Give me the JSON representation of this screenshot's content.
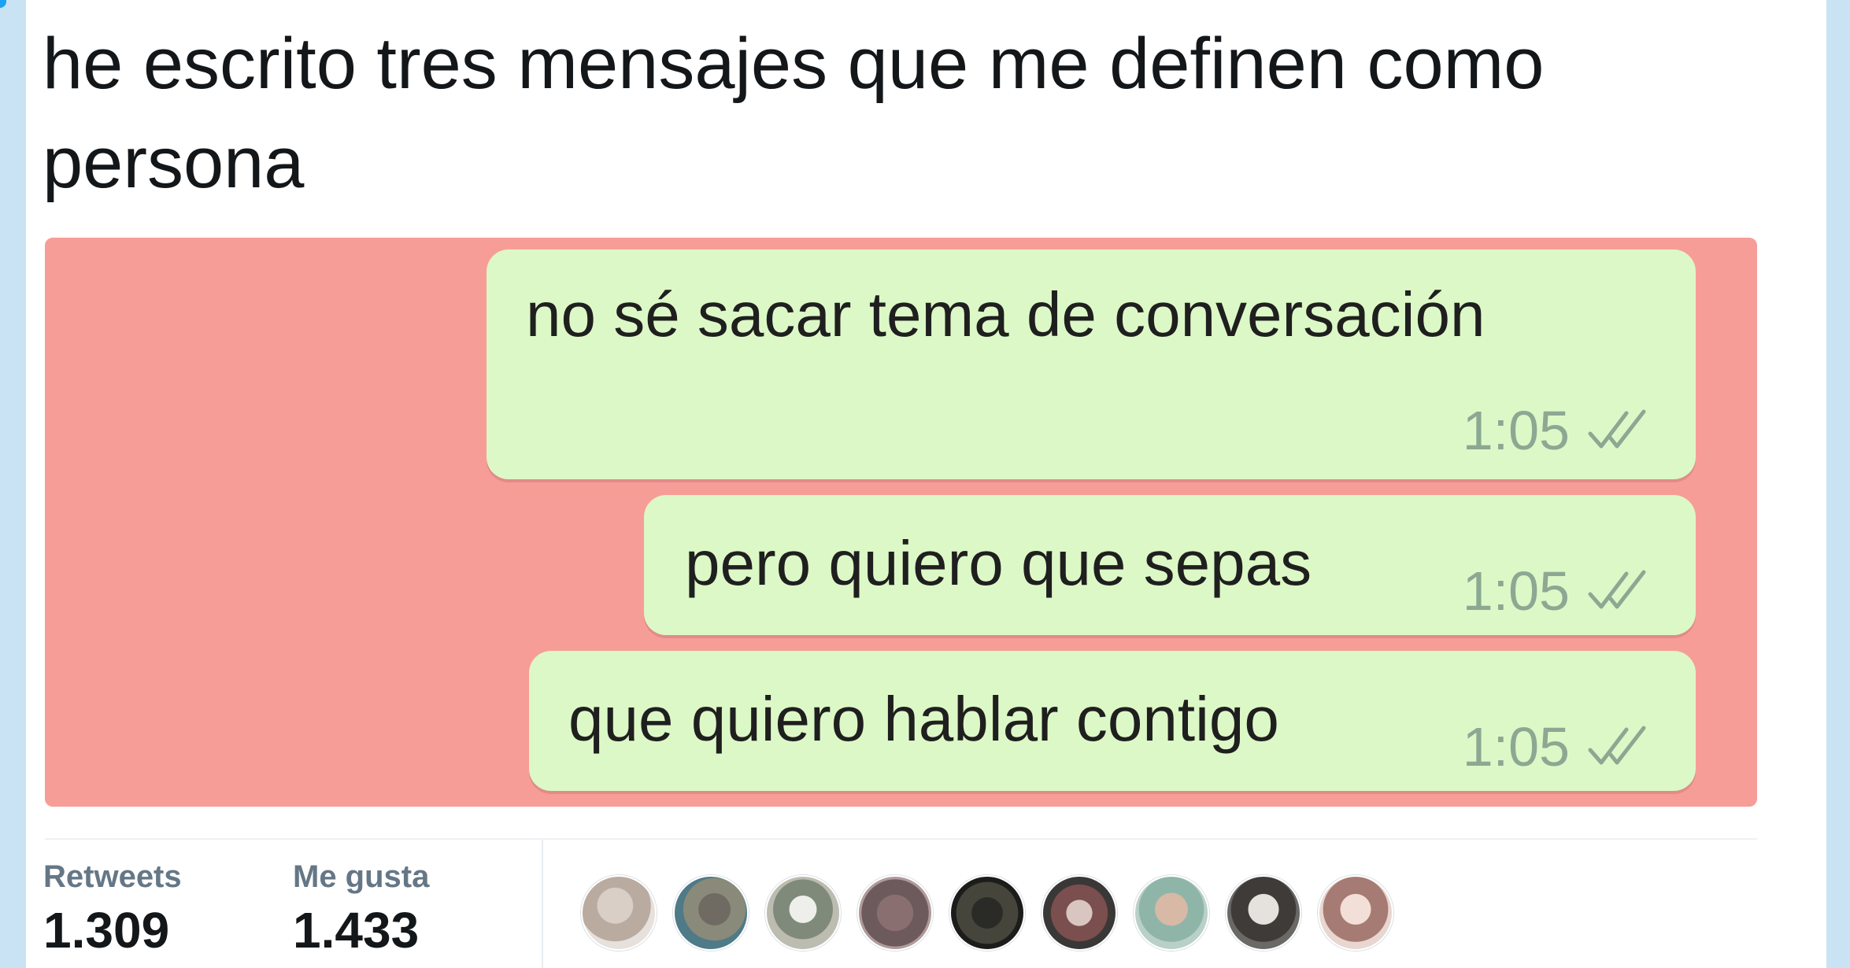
{
  "tweet": {
    "text": "he escrito tres mensajes que me definen como persona"
  },
  "messages": [
    {
      "text": "no sé sacar tema de conversación",
      "time": "1:05",
      "status_icon": "double-check-icon"
    },
    {
      "text": "pero quiero que sepas",
      "time": "1:05",
      "status_icon": "double-check-icon"
    },
    {
      "text": "que quiero hablar contigo",
      "time": "1:05",
      "status_icon": "double-check-icon"
    }
  ],
  "stats": {
    "retweets_label": "Retweets",
    "retweets_value": "1.309",
    "likes_label": "Me gusta",
    "likes_value": "1.433"
  },
  "colors": {
    "media_background": "#f79d98",
    "bubble_background": "#dcf8c6",
    "page_background": "#cfe6f5",
    "card_background": "#ffffff"
  }
}
